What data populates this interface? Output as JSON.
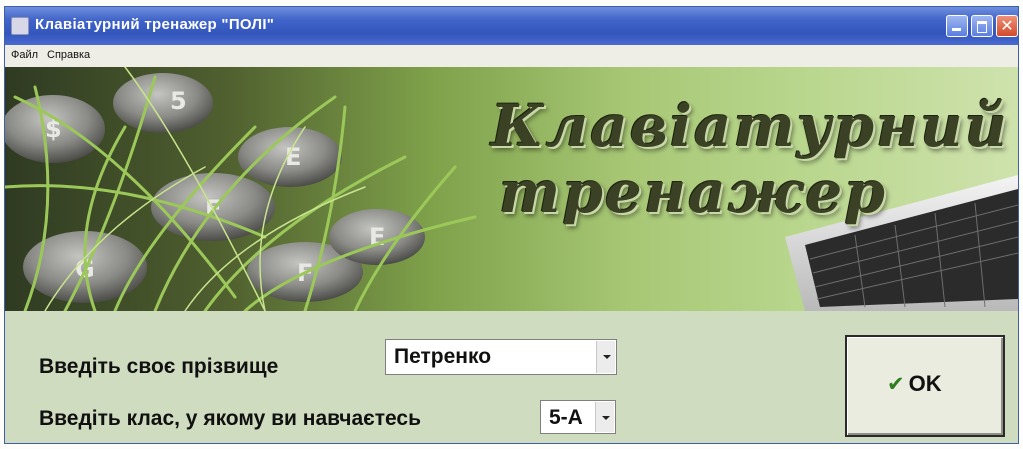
{
  "window": {
    "title": "Клавіатурний тренажер \"ПОЛІ\"",
    "controls": [
      "minimize-icon",
      "maximize-icon",
      "close-icon"
    ],
    "close_glyph": "✕"
  },
  "menu": {
    "items": [
      {
        "label": "Файл"
      },
      {
        "label": "Справка"
      }
    ]
  },
  "banner": {
    "title_line1": "Клавіатурний",
    "title_line2": "тренажер",
    "key_letters": [
      "$",
      "5",
      "F",
      "E",
      "G",
      "F",
      "E"
    ]
  },
  "form": {
    "surname_label": "Введіть своє прізвище",
    "surname_value": "Петренко",
    "class_label": "Введіть клас, у якому ви навчаєтесь",
    "class_value": "5-А"
  },
  "ok_button": {
    "icon": "checkmark-icon",
    "check_glyph": "✔",
    "label": "OK"
  },
  "colors": {
    "titlebar": "#3356bd",
    "form_background": "#cfdcbf",
    "checkmark": "#2e7d1f"
  }
}
